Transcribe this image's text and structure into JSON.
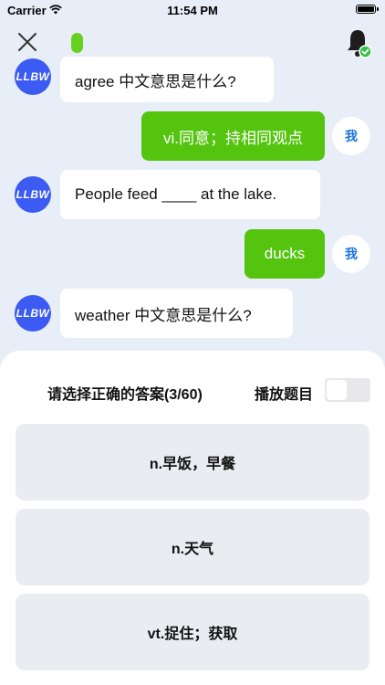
{
  "status_bar": {
    "carrier": "Carrier",
    "time": "11:54 PM"
  },
  "header": {
    "close_icon": "close-icon",
    "bell_icon": "bell-icon",
    "pill_color": "#66d120"
  },
  "messages": [
    {
      "sender": "bot",
      "avatar": "LLBW",
      "text": "agree 中文意思是什么?"
    },
    {
      "sender": "user",
      "badge": "我",
      "text": "vi.同意；持相同观点"
    },
    {
      "sender": "bot",
      "avatar": "LLBW",
      "text": "People feed ____  at the lake."
    },
    {
      "sender": "user",
      "badge": "我",
      "text": "ducks"
    },
    {
      "sender": "bot",
      "avatar": "LLBW",
      "text": "weather 中文意思是什么?"
    }
  ],
  "quiz": {
    "title": "请选择正确的答案(3/60)",
    "play_label": "播放题目",
    "toggle_on": false,
    "options": [
      "n.早饭，早餐",
      "n.天气",
      "vt.捉住；获取"
    ]
  },
  "colors": {
    "accent_green": "#55c40f",
    "avatar_blue": "#3b5bf2",
    "badge_blue": "#1a73d9",
    "background": "#e8eef7"
  }
}
